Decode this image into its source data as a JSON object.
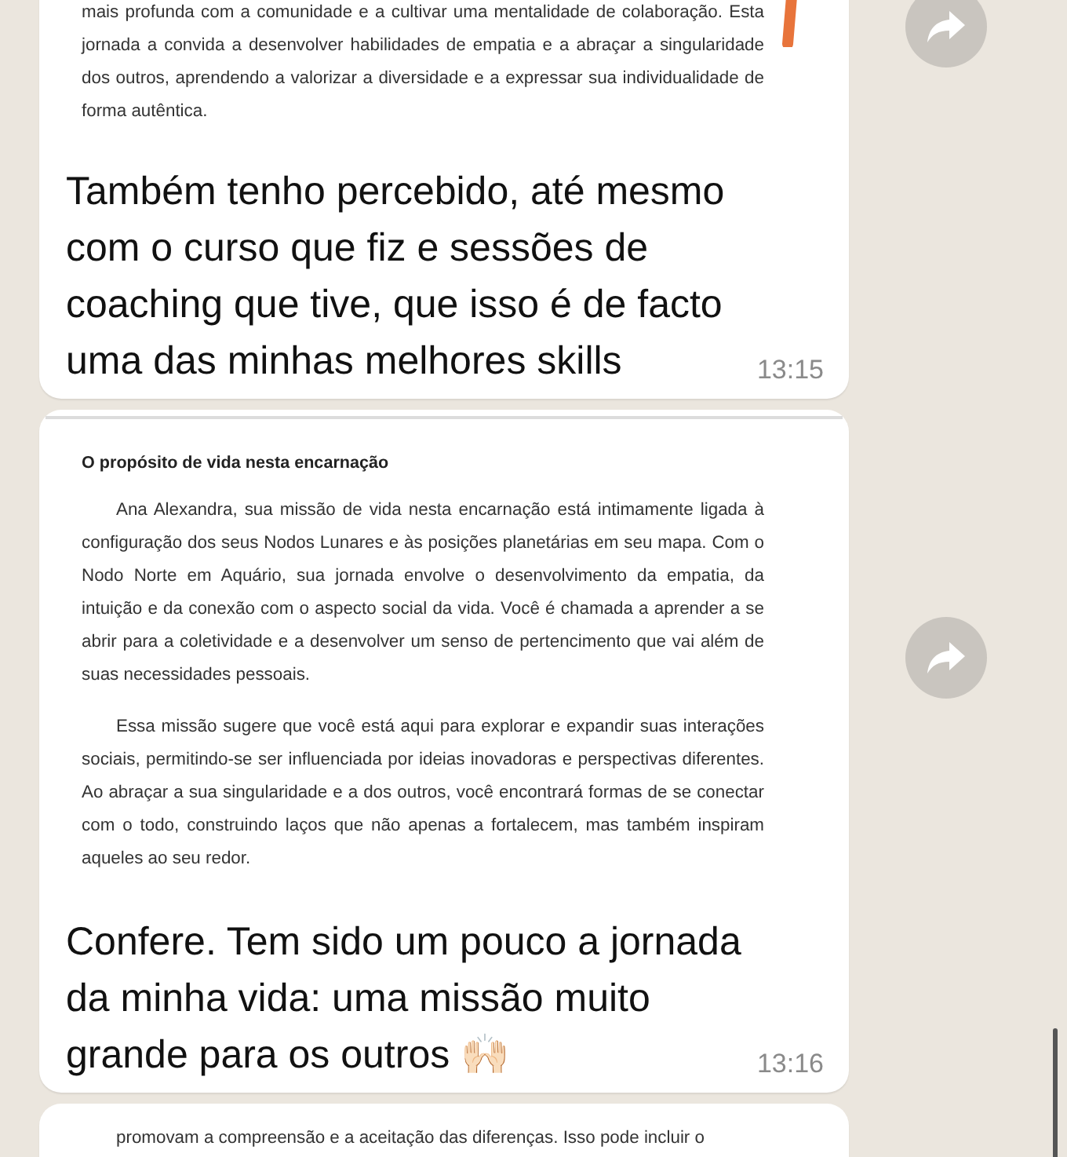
{
  "messages": [
    {
      "document": {
        "paragraphs": [
          {
            "text": "mais profunda com a comunidade e a cultivar uma mentalidade de colaboração. Esta jornada a convida a desenvolver habilidades de empatia e a abraçar a singularidade dos outros, aprendendo a valorizar a diversidade e a expressar sua individualidade de forma autêntica.",
            "indent": false
          }
        ]
      },
      "caption": "Também tenho percebido, até mesmo com o curso que fiz e sessões de coaching que tive, que isso é de facto uma das minhas melhores skills",
      "time": "13:15",
      "forward": true,
      "highlight_mark": true
    },
    {
      "document": {
        "heading": "O propósito de vida nesta encarnação",
        "paragraphs": [
          {
            "text": "Ana Alexandra, sua missão de vida nesta encarnação está intimamente ligada à configuração dos seus Nodos Lunares e às posições planetárias em seu mapa. Com o Nodo Norte em Aquário, sua jornada envolve o desenvolvimento da empatia, da intuição e da conexão com o aspecto social da vida. Você é chamada a aprender a se abrir para a coletividade e a desenvolver um senso de pertencimento que vai além de suas necessidades pessoais.",
            "indent": true
          },
          {
            "text": "Essa missão sugere que você está aqui para explorar e expandir suas interações sociais, permitindo-se ser influenciada por ideias inovadoras e perspectivas diferentes. Ao abraçar a sua singularidade e a dos outros, você encontrará formas de se conectar com o todo, construindo laços que não apenas a fortalecem, mas também inspiram aqueles ao seu redor.",
            "indent": true
          }
        ]
      },
      "caption": "Confere. Tem sido um pouco a jornada da minha vida: uma missão muito grande para os outros 🙌🏻",
      "time": "13:16",
      "forward": true,
      "highlight_mark": false
    },
    {
      "document": {
        "paragraphs": [
          {
            "text": "promovam a compreensão e a aceitação das diferenças. Isso pode incluir o",
            "indent": true
          }
        ]
      }
    }
  ]
}
